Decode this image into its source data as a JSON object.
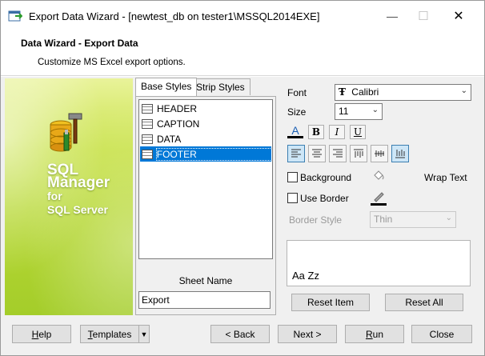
{
  "window": {
    "title": "Export Data Wizard - [newtest_db on tester1\\MSSQL2014EXE]",
    "minimize_glyph": "—",
    "maximize_glyph": "☐",
    "close_glyph": "✕"
  },
  "header": {
    "title": "Data Wizard - Export Data",
    "subtitle": "Customize MS Excel export options."
  },
  "banner": {
    "line1": "SQL",
    "line2": "Manager",
    "line3": "for",
    "line4": "SQL Server"
  },
  "tabs": [
    {
      "label": "Base Styles",
      "active": true
    },
    {
      "label": "Strip Styles",
      "active": false
    }
  ],
  "styles_list": [
    {
      "label": "HEADER",
      "selected": false
    },
    {
      "label": "CAPTION",
      "selected": false
    },
    {
      "label": "DATA",
      "selected": false
    },
    {
      "label": "FOOTER",
      "selected": true
    }
  ],
  "sheet": {
    "label": "Sheet Name",
    "value": "Export"
  },
  "font": {
    "label": "Font",
    "value": "Calibri",
    "font_icon": "Ŧ"
  },
  "size": {
    "label": "Size",
    "value": "11"
  },
  "format_buttons": {
    "color": "A",
    "bold": "B",
    "italic": "I",
    "underline": "U"
  },
  "background": {
    "label": "Background",
    "checked": false
  },
  "use_border": {
    "label": "Use Border",
    "checked": false
  },
  "wrap_text": {
    "label": "Wrap Text"
  },
  "border_style": {
    "label": "Border Style",
    "value": "Thin"
  },
  "preview": {
    "text": "Aa Zz"
  },
  "buttons": {
    "reset_item": "Reset Item",
    "reset_all": "Reset All"
  },
  "footer": {
    "help": "Help",
    "templates": "Templates",
    "back": "< Back",
    "next": "Next >",
    "run": "Run",
    "close": "Close"
  },
  "colors": {
    "selection": "#0078d7",
    "banner_green": "#b7d834"
  }
}
